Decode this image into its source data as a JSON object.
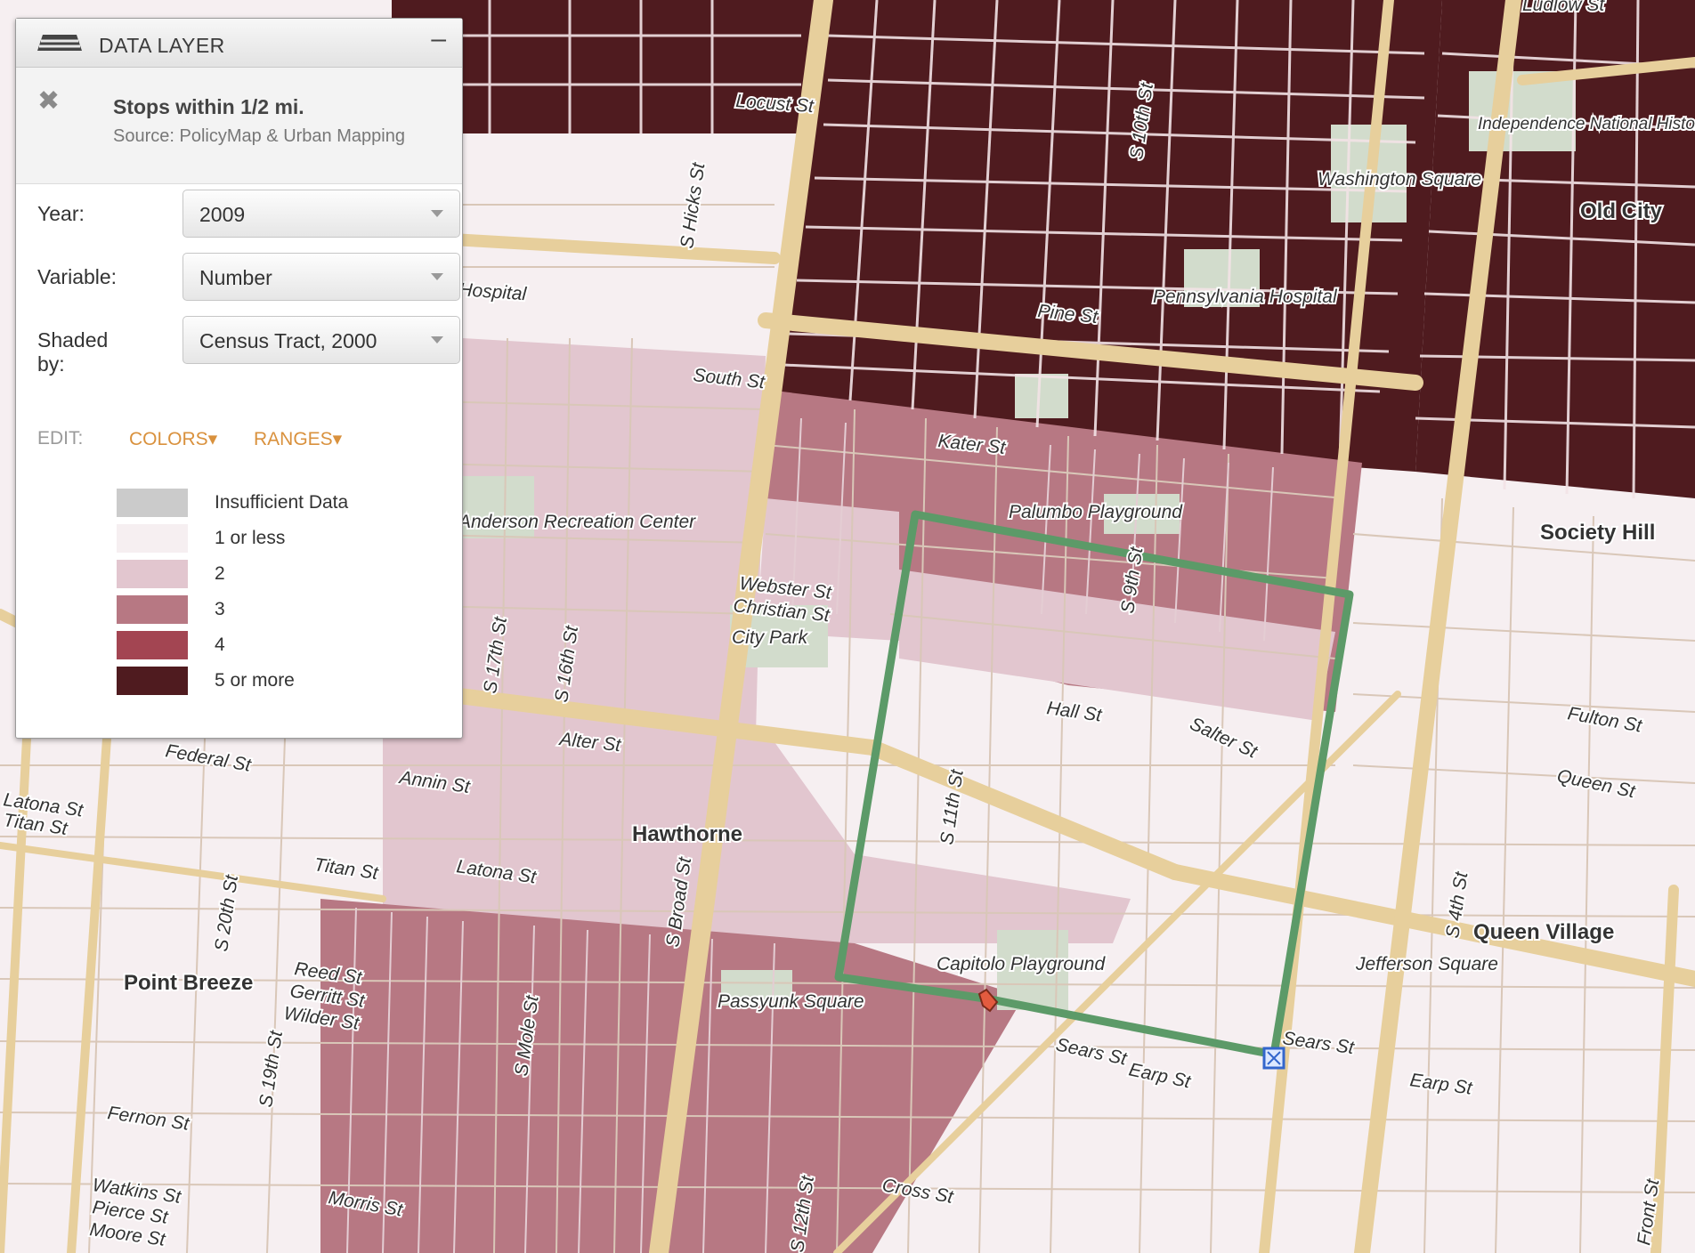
{
  "panel": {
    "title": "DATA LAYER",
    "minimize": "–",
    "close": "✖",
    "layer_name": "Stops within 1/2 mi.",
    "layer_source": "Source: PolicyMap & Urban Mapping",
    "year": {
      "label": "Year:",
      "value": "2009"
    },
    "variable": {
      "label": "Variable:",
      "value": "Number"
    },
    "shaded_by": {
      "label": "Shaded by:",
      "value": "Census Tract, 2000"
    },
    "edit_label": "EDIT:",
    "colors_label": "COLORS▾",
    "ranges_label": "RANGES▾",
    "legend": [
      {
        "label": "Insufficient Data",
        "color": "#cbcbcb"
      },
      {
        "label": "1 or less",
        "color": "#f6eff1"
      },
      {
        "label": "2",
        "color": "#e2c6cf"
      },
      {
        "label": "3",
        "color": "#b77883"
      },
      {
        "label": "4",
        "color": "#a34552"
      },
      {
        "label": "5 or more",
        "color": "#4f1b1f"
      }
    ]
  },
  "map": {
    "colors": {
      "dark": "#4f1b1f",
      "mid": "#b77883",
      "light": "#e2c6cf",
      "lightest": "#f6eff1",
      "road": "#e7cf9c",
      "route": "#5c9a68",
      "park": "#d2dccc"
    },
    "street_labels": [
      "Locust St",
      "S Hicks St",
      "S 10th St",
      "Washington Square",
      "Independence National Historical Pk",
      "Old City",
      "Pine St",
      "Pennsylvania Hospital",
      "South St",
      "Kater St",
      "Palumbo Playground",
      "Society Hill",
      "Webster St",
      "Christian St",
      "City Park",
      "S 9th St",
      "Hall St",
      "Salter St",
      "Fulton St",
      "Queen St",
      "Anderson Recreation Center",
      "S 17th St",
      "S 16th St",
      "Federal St",
      "Alter St",
      "Annin St",
      "Hawthorne",
      "S 11th St",
      "Latona St",
      "Titan St",
      "S Broad St",
      "Queen Village",
      "Jefferson Square",
      "S 4th St",
      "Point Breeze",
      "S 20th St",
      "Reed St",
      "Gerritt St",
      "Wilder St",
      "Capitolo Playground",
      "Passyunk Square",
      "S Mole St",
      "S 19th St",
      "Fernon St",
      "Watkins St",
      "Pierce St",
      "Moore St",
      "Morris St",
      "Cross St",
      "Sears St",
      "Earp St",
      "S 12th St",
      "Front St",
      "Ludlow St",
      "Hospital",
      "Latona St",
      "Titan St",
      "Sears St",
      "Earp St"
    ]
  }
}
